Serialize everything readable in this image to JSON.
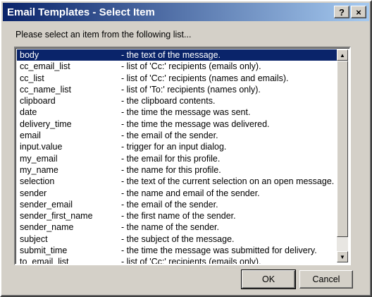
{
  "window": {
    "title": "Email Templates - Select Item",
    "help_label": "?",
    "close_label": "×"
  },
  "instruction": "Please select an item from the following list...",
  "list": {
    "selected_index": 0,
    "items": [
      {
        "name": "body",
        "desc": "- the text of the message."
      },
      {
        "name": "cc_email_list",
        "desc": "- list of 'Cc:' recipients (emails only)."
      },
      {
        "name": "cc_list",
        "desc": "- list of 'Cc:' recipients (names and emails)."
      },
      {
        "name": "cc_name_list",
        "desc": "- list of 'To:' recipients (names only)."
      },
      {
        "name": "clipboard",
        "desc": "- the clipboard contents."
      },
      {
        "name": "date",
        "desc": "- the time the message was sent."
      },
      {
        "name": "delivery_time",
        "desc": "- the time the message was delivered."
      },
      {
        "name": "email",
        "desc": "- the email of the sender."
      },
      {
        "name": "input.value",
        "desc": "- trigger for an input dialog."
      },
      {
        "name": "my_email",
        "desc": "- the email for this profile."
      },
      {
        "name": "my_name",
        "desc": "- the name for this profile."
      },
      {
        "name": "selection",
        "desc": "- the text of the current selection on an open message."
      },
      {
        "name": "sender",
        "desc": "- the name and email of the sender."
      },
      {
        "name": "sender_email",
        "desc": "- the email of the sender."
      },
      {
        "name": "sender_first_name",
        "desc": "- the first name of the sender."
      },
      {
        "name": "sender_name",
        "desc": "- the name of the sender."
      },
      {
        "name": "subject",
        "desc": "- the subject of the message."
      },
      {
        "name": "submit_time",
        "desc": "- the time the message was submitted for delivery."
      },
      {
        "name": "to_email_list",
        "desc": "- list of 'Cc:' recipients (emails only)."
      }
    ]
  },
  "buttons": {
    "ok_label": "OK",
    "cancel_label": "Cancel"
  },
  "colors": {
    "selection_bg": "#0a246a",
    "title_gradient_start": "#0a246a",
    "title_gradient_end": "#a6caf0"
  },
  "icons": {
    "scroll_up": "up-arrow-icon",
    "scroll_down": "down-arrow-icon"
  }
}
